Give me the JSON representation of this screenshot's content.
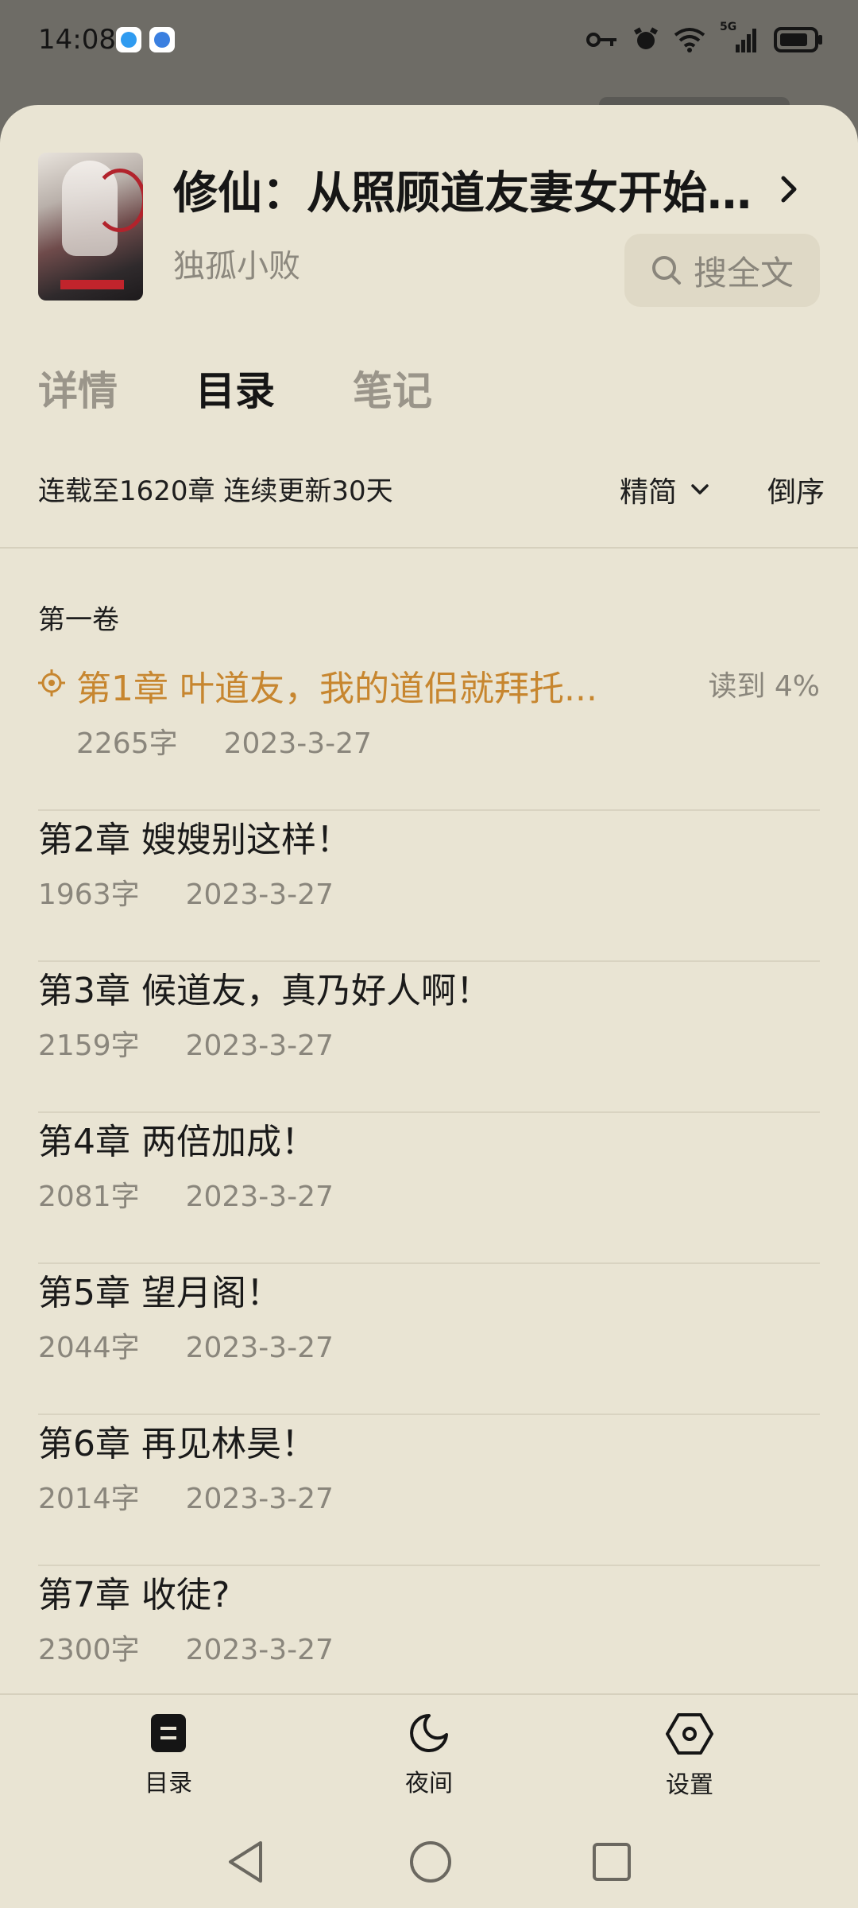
{
  "status_bar": {
    "time": "14:08",
    "network_label": "5G"
  },
  "book": {
    "title": "修仙：从照顾道友妻女开始（...",
    "author": "独孤小败",
    "search_label": "搜全文"
  },
  "tabs": [
    {
      "label": "详情",
      "active": false
    },
    {
      "label": "目录",
      "active": true
    },
    {
      "label": "笔记",
      "active": false
    }
  ],
  "catalog": {
    "update_info": "连载至1620章 连续更新30天",
    "version_label": "精简",
    "order_label": "倒序",
    "volume": "第一卷",
    "chapters": [
      {
        "title": "第1章 叶道友，我的道侣就拜托...",
        "words": "2265字",
        "date": "2023-3-27",
        "progress": "读到 4%",
        "current": true
      },
      {
        "title": "第2章 嫂嫂别这样！",
        "words": "1963字",
        "date": "2023-3-27"
      },
      {
        "title": "第3章 候道友，真乃好人啊！",
        "words": "2159字",
        "date": "2023-3-27"
      },
      {
        "title": "第4章 两倍加成！",
        "words": "2081字",
        "date": "2023-3-27"
      },
      {
        "title": "第5章 望月阁！",
        "words": "2044字",
        "date": "2023-3-27"
      },
      {
        "title": "第6章 再见林昊！",
        "words": "2014字",
        "date": "2023-3-27"
      },
      {
        "title": "第7章 收徒?",
        "words": "2300字",
        "date": "2023-3-27"
      }
    ]
  },
  "bottom_nav": [
    {
      "label": "目录",
      "icon": "catalog-icon"
    },
    {
      "label": "夜间",
      "icon": "moon-icon"
    },
    {
      "label": "设置",
      "icon": "settings-icon"
    }
  ],
  "colors": {
    "sheet_bg": "#e9e4d3",
    "accent_current": "#c7862f",
    "muted_text": "#8a867c"
  }
}
